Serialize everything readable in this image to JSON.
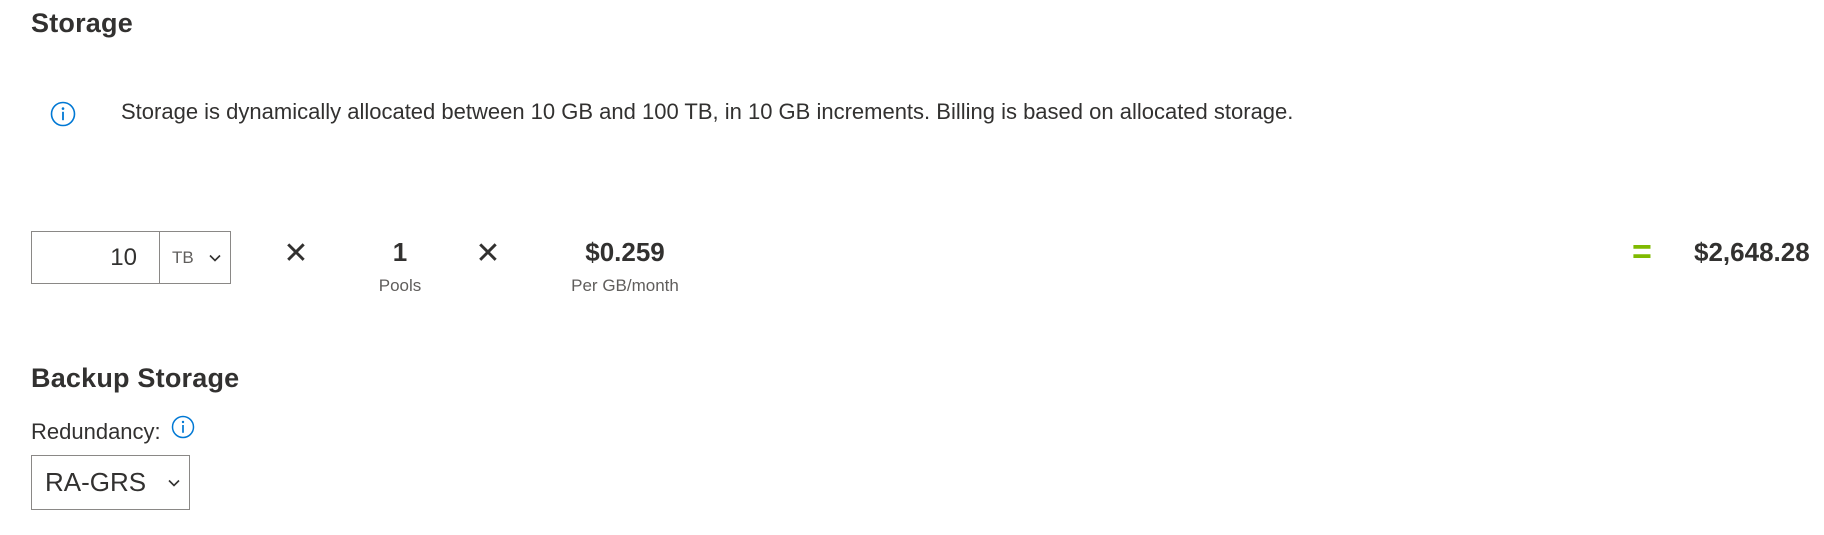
{
  "storage": {
    "title": "Storage",
    "info_icon": "info-circle-icon",
    "info_text": "Storage is dynamically allocated between 10 GB and 100 TB, in 10 GB increments. Billing is based on allocated storage.",
    "quantity_value": "10",
    "unit_selected": "TB",
    "unit_dropdown_icon": "chevron-down-icon",
    "multiply_symbol": "✕",
    "pools_value": "1",
    "pools_caption": "Pools",
    "price_value": "$0.259",
    "price_caption": "Per GB/month",
    "equals_symbol": "=",
    "total": "$2,648.28"
  },
  "backup": {
    "title": "Backup Storage",
    "redundancy_label": "Redundancy:",
    "redundancy_info_icon": "info-circle-icon",
    "redundancy_selected": "RA-GRS",
    "redundancy_dropdown_icon": "chevron-down-icon"
  },
  "colors": {
    "accent_blue": "#0078d4",
    "equals_green": "#7fba00",
    "text": "#323130",
    "secondary_text": "#605e5c",
    "border": "#8a8886"
  }
}
